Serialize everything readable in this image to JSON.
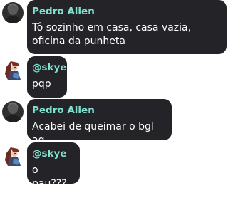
{
  "messages": [
    {
      "sender": "Pedro Alien",
      "text": "Tô sozinho em casa, casa vazia, oficina da punheta",
      "avatar": "profile-photo-icon"
    },
    {
      "sender": "@skye",
      "text": "pqp",
      "avatar": "anime-character-icon"
    },
    {
      "sender": "Pedro Alien",
      "text": "Acabei de queimar o bgl aq",
      "avatar": "profile-photo-icon"
    },
    {
      "sender": "@skye",
      "text": "o pau???",
      "avatar": "anime-character-icon"
    }
  ],
  "colors": {
    "bubble": "#242327",
    "name": "#7fe3d1",
    "text": "#ffffff",
    "background": "#ffffff"
  }
}
